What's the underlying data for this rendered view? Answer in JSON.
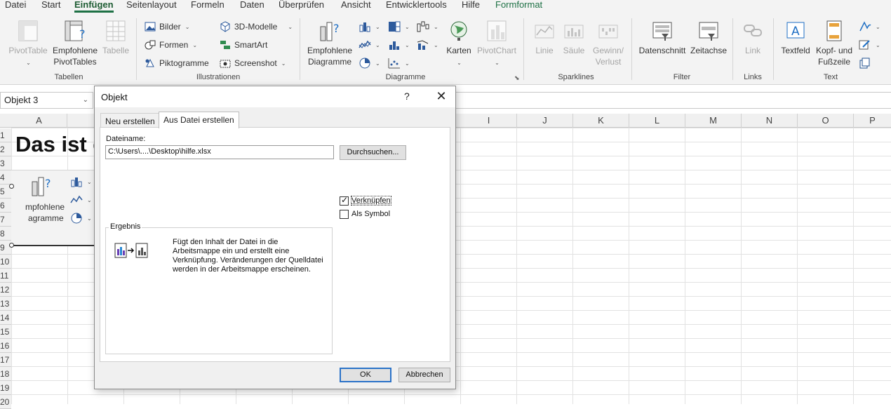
{
  "menu": {
    "tabs": [
      "Datei",
      "Start",
      "Einfügen",
      "Seitenlayout",
      "Formeln",
      "Daten",
      "Überprüfen",
      "Ansicht",
      "Entwicklertools",
      "Hilfe",
      "Formformat"
    ]
  },
  "ribbon": {
    "tables": {
      "label": "Tabellen",
      "pivottable": "PivotTable",
      "recommended_pivot_1": "Empfohlene",
      "recommended_pivot_2": "PivotTables",
      "table": "Tabelle"
    },
    "illustrations": {
      "label": "Illustrationen",
      "pictures": "Bilder",
      "shapes": "Formen",
      "icons": "Piktogramme",
      "models_3d": "3D-Modelle",
      "smartart": "SmartArt",
      "screenshot": "Screenshot"
    },
    "charts": {
      "label": "Diagramme",
      "recommended_1": "Empfohlene",
      "recommended_2": "Diagramme",
      "maps": "Karten",
      "pivotchart": "PivotChart"
    },
    "sparklines": {
      "label": "Sparklines",
      "line": "Linie",
      "column": "Säule",
      "winloss_1": "Gewinn/",
      "winloss_2": "Verlust"
    },
    "filter": {
      "label": "Filter",
      "slicer": "Datenschnitt",
      "timeline": "Zeitachse"
    },
    "links": {
      "label": "Links",
      "link": "Link"
    },
    "text": {
      "label": "Text",
      "textbox": "Textfeld",
      "header_footer_1": "Kopf- und",
      "header_footer_2": "Fußzeile"
    }
  },
  "namebox": {
    "value": "Objekt 3"
  },
  "columns": [
    "A",
    "I",
    "J",
    "K",
    "L",
    "M",
    "N",
    "O",
    "P"
  ],
  "rows": [
    "1",
    "2",
    "3",
    "4",
    "5",
    "6",
    "7",
    "8",
    "9",
    "10",
    "11",
    "12",
    "13",
    "14",
    "15",
    "16",
    "17",
    "18",
    "19",
    "20"
  ],
  "sheet": {
    "heading": "Das ist e",
    "embed_line1": "mpfohlene",
    "embed_line2": "agramme"
  },
  "dialog": {
    "title": "Objekt",
    "help": "?",
    "close": "✕",
    "tab_new": "Neu erstellen",
    "tab_from_file": "Aus Datei erstellen",
    "filename_label": "Dateiname:",
    "filename_value": "C:\\Users\\....\\Desktop\\hilfe.xlsx",
    "browse": "Durchsuchen...",
    "link_label": "Verknüpfen",
    "link_checked": true,
    "symbol_label": "Als Symbol",
    "symbol_checked": false,
    "result_title": "Ergebnis",
    "result_text": "Fügt den Inhalt der Datei in die Arbeitsmappe ein und erstellt eine Verknüpfung. Veränderungen der Quelldatei werden in der Arbeitsmappe erscheinen.",
    "ok": "OK",
    "cancel": "Abbrechen"
  },
  "colors": {
    "accent": "#1e7145",
    "focus_blue": "#2a72c8"
  },
  "icons": [
    "pivottable-icon",
    "recommended-pivot-icon",
    "table-icon",
    "pictures-icon",
    "shapes-icon",
    "icons-icon",
    "3d-models-icon",
    "smartart-icon",
    "screenshot-icon",
    "recommended-charts-icon",
    "maps-icon",
    "pivotchart-icon",
    "sparkline-line-icon",
    "sparkline-column-icon",
    "sparkline-winloss-icon",
    "slicer-icon",
    "timeline-icon",
    "link-icon",
    "textbox-icon",
    "header-footer-icon",
    "close-icon",
    "checkmark-icon",
    "link-file-icon"
  ]
}
